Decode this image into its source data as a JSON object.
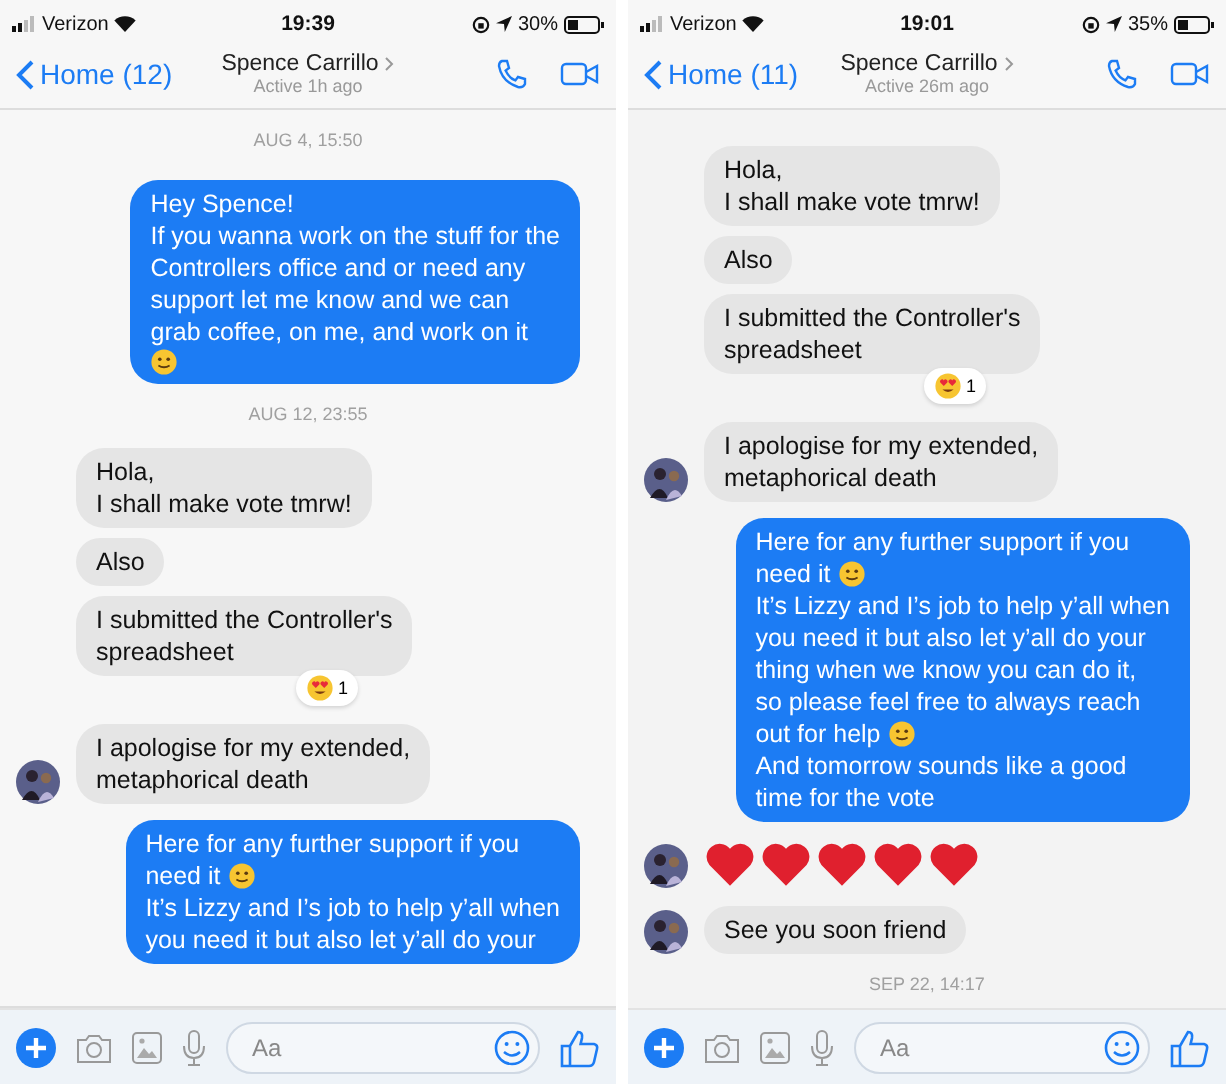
{
  "phones": [
    {
      "status": {
        "carrier": "Verizon",
        "time": "19:39",
        "battery": "30%"
      },
      "nav": {
        "back": "Home (12)",
        "name": "Spence Carrillo",
        "subtitle": "Active 1h ago"
      },
      "scrolled_to_bottom": false,
      "composer": {
        "placeholder": "Aa"
      },
      "messages": [
        {
          "kind": "time",
          "text": "AUG 4, 15:50"
        },
        {
          "kind": "out",
          "lines": [
            {
              "text": "Hey Spence!"
            },
            {
              "text": "If you wanna work on the stuff for the"
            },
            {
              "text": "Controllers office and or need any"
            },
            {
              "text": "support let me know and we can"
            },
            {
              "text": "grab coffee, on me, and work on it"
            },
            {
              "emoji": true
            }
          ]
        },
        {
          "kind": "time",
          "text": "AUG 12, 23:55"
        },
        {
          "kind": "in",
          "avatar": false,
          "lines": [
            {
              "text": "Hola,"
            },
            {
              "text": "I shall make vote tmrw!"
            }
          ]
        },
        {
          "kind": "in",
          "avatar": false,
          "lines": [
            {
              "text": "Also"
            }
          ]
        },
        {
          "kind": "in",
          "avatar": false,
          "lines": [
            {
              "text": "I submitted the Controller's"
            },
            {
              "text": "spreadsheet"
            }
          ]
        },
        {
          "kind": "reaction",
          "count": "1"
        },
        {
          "kind": "in",
          "avatar": true,
          "lines": [
            {
              "text": "I apologise for my extended,"
            },
            {
              "text": "metaphorical death"
            }
          ]
        },
        {
          "kind": "out",
          "lines": [
            {
              "text": "Here for any further support if you"
            },
            {
              "text": "need it",
              "emoji": true
            },
            {
              "text": "It’s Lizzy and I’s job to help y’all when"
            },
            {
              "text": "you need it but also let y’all do your"
            }
          ]
        }
      ]
    },
    {
      "status": {
        "carrier": "Verizon",
        "time": "19:01",
        "battery": "35%"
      },
      "nav": {
        "back": "Home (11)",
        "name": "Spence Carrillo",
        "subtitle": "Active 26m ago"
      },
      "scrolled_to_bottom": true,
      "composer": {
        "placeholder": "Aa"
      },
      "messages": [
        {
          "kind": "in",
          "avatar": false,
          "lines": [
            {
              "text": "Hola,"
            },
            {
              "text": "I shall make vote tmrw!"
            }
          ]
        },
        {
          "kind": "in",
          "avatar": false,
          "lines": [
            {
              "text": "Also"
            }
          ]
        },
        {
          "kind": "in",
          "avatar": false,
          "lines": [
            {
              "text": "I submitted the Controller's"
            },
            {
              "text": "spreadsheet"
            }
          ]
        },
        {
          "kind": "reaction",
          "count": "1"
        },
        {
          "kind": "in",
          "avatar": true,
          "lines": [
            {
              "text": "I apologise for my extended,"
            },
            {
              "text": "metaphorical death"
            }
          ]
        },
        {
          "kind": "out",
          "lines": [
            {
              "text": "Here for any further support if you"
            },
            {
              "text": "need it",
              "emoji": true
            },
            {
              "text": "It’s Lizzy and I’s job to help y’all when"
            },
            {
              "text": "you need it but also let y’all do your"
            },
            {
              "text": "thing when we know you can do it,"
            },
            {
              "text": "so please feel free to always reach"
            },
            {
              "text": "out for help",
              "emoji": true
            },
            {
              "text": "And tomorrow sounds like a good"
            },
            {
              "text": "time for the vote"
            }
          ]
        },
        {
          "kind": "hearts",
          "avatar": true,
          "items": [
            {
              "kind": "heart"
            },
            {
              "kind": "heart"
            },
            {
              "kind": "heart"
            },
            {
              "kind": "heart"
            },
            {
              "kind": "heart"
            }
          ]
        },
        {
          "kind": "in",
          "avatar": true,
          "lines": [
            {
              "text": "See you soon friend"
            }
          ]
        },
        {
          "kind": "time",
          "text": "SEP 22, 14:17"
        }
      ]
    }
  ]
}
